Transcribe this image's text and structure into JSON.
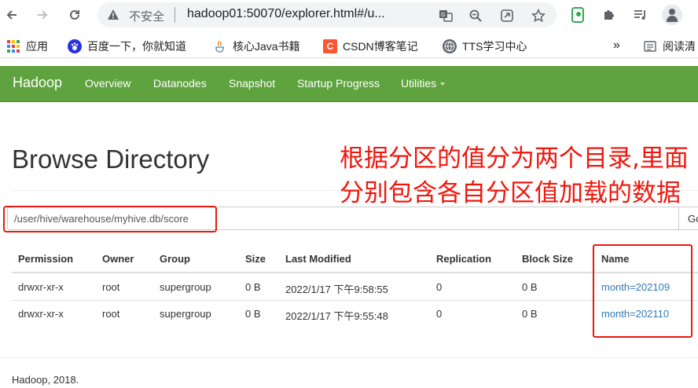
{
  "browser": {
    "security_label": "不安全",
    "url": "hadoop01:50070/explorer.html#/u...",
    "bookmarks": [
      {
        "label": "应用"
      },
      {
        "label": "百度一下，你就知道"
      },
      {
        "label": "核心Java书籍"
      },
      {
        "label": "CSDN博客笔记"
      },
      {
        "label": "TTS学习中心"
      },
      {
        "label": "阅读清"
      }
    ],
    "overflow_label": "»"
  },
  "navbar": {
    "brand": "Hadoop",
    "items": [
      {
        "label": "Overview"
      },
      {
        "label": "Datanodes"
      },
      {
        "label": "Snapshot"
      },
      {
        "label": "Startup Progress"
      },
      {
        "label": "Utilities"
      }
    ],
    "color": "#5fa33e"
  },
  "page": {
    "title": "Browse Directory",
    "path_value": "/user/hive/warehouse/myhive.db/score",
    "go_label": "Go!"
  },
  "annotation": {
    "text": "根据分区的值分为两个目录,里面分别包含各自分区值加载的数据",
    "color": "#f0160c"
  },
  "table": {
    "headers": [
      "Permission",
      "Owner",
      "Group",
      "Size",
      "Last Modified",
      "Replication",
      "Block Size",
      "Name"
    ],
    "rows": [
      [
        "drwxr-xr-x",
        "root",
        "supergroup",
        "0 B",
        "2022/1/17 下午9:58:55",
        "0",
        "0 B",
        "month=202109"
      ],
      [
        "drwxr-xr-x",
        "root",
        "supergroup",
        "0 B",
        "2022/1/17 下午9:55:48",
        "0",
        "0 B",
        "month=202110"
      ]
    ]
  },
  "footer": {
    "text": "Hadoop, 2018."
  }
}
